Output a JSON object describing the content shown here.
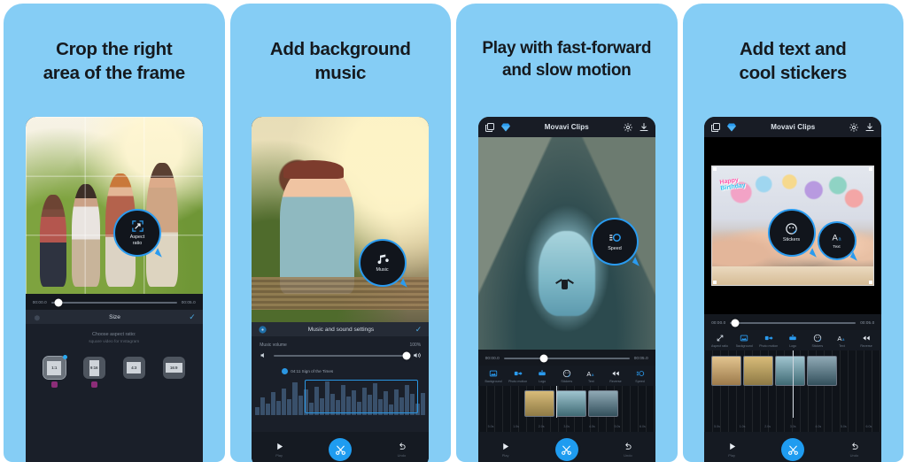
{
  "theme": {
    "panel_bg": "#85cdf5",
    "page_bg": "#ffffff",
    "accent": "#1f9cf0",
    "callout_border": "#2a9bef",
    "phone_bg": "#11141b",
    "heading_color": "#15191e"
  },
  "app": {
    "name": "Movavi Clips"
  },
  "panels": [
    {
      "id": "crop",
      "headline_line1": "Crop the right",
      "headline_line2": "area of the frame",
      "callout": {
        "label_line1": "Aspect",
        "label_line2": "ratio",
        "icon": "aspect-ratio-icon"
      },
      "seek": {
        "start_time": "00:00.0",
        "end_time": "00:05.0"
      },
      "section": {
        "title": "Size",
        "confirm_icon": "check-icon",
        "gear_icon": "gear-icon",
        "prompt": "Choose aspect ratio:",
        "hint": "square video for Instagram",
        "ratios": [
          {
            "label": "1:1",
            "selected": true,
            "pro": true
          },
          {
            "label": "9:16",
            "selected": false,
            "pro": true
          },
          {
            "label": "4:3",
            "selected": false,
            "pro": false
          },
          {
            "label": "16:9",
            "selected": false,
            "pro": false
          }
        ]
      }
    },
    {
      "id": "music",
      "headline_line1": "Add background",
      "headline_line2": "music",
      "callout": {
        "label_line1": "Music",
        "label_line2": "",
        "icon": "music-note-icon"
      },
      "section": {
        "title": "Music and sound settings",
        "confirm_icon": "check-icon",
        "gear_icon": "gear-icon",
        "volume_label": "Music volume",
        "volume_value": "100%",
        "volume_min_icon": "speaker-low-icon",
        "volume_max_icon": "speaker-high-icon",
        "track_name": "04:11 Sign of the Times"
      },
      "bottombar": {
        "play_label": "Play",
        "undo_label": "Undo",
        "cut_icon": "scissors-icon"
      }
    },
    {
      "id": "speed",
      "headline_line1": "Play with fast-forward",
      "headline_line2": "and slow motion",
      "callout": {
        "label_line1": "Speed",
        "label_line2": "",
        "icon": "speed-icon"
      },
      "header": {
        "title": "Movavi Clips",
        "left_icons": [
          "layers-icon",
          "diamond-icon"
        ],
        "right_icons": [
          "gear-icon",
          "download-icon"
        ]
      },
      "seek": {
        "start_time": "00:00.0",
        "end_time": "00:05.0"
      },
      "tools": [
        {
          "label": "Background",
          "icon": "background-icon"
        },
        {
          "label": "Photo motion",
          "icon": "photo-motion-icon"
        },
        {
          "label": "Logo",
          "icon": "logo-icon"
        },
        {
          "label": "Stickers",
          "icon": "stickers-icon"
        },
        {
          "label": "Text",
          "icon": "text-icon"
        },
        {
          "label": "Reverse",
          "icon": "reverse-icon"
        },
        {
          "label": "Speed",
          "icon": "speed-icon"
        }
      ],
      "timeline": {
        "times": [
          "5.0s",
          "1.0s",
          "2.0s",
          "3.0s",
          "4.0s",
          "5.0s",
          "6.0s"
        ]
      },
      "bottombar": {
        "play_label": "Play",
        "undo_label": "Undo",
        "cut_icon": "scissors-icon"
      }
    },
    {
      "id": "text-stickers",
      "headline_line1": "Add text and",
      "headline_line2": "cool stickers",
      "callouts": [
        {
          "label_line1": "Stickers",
          "label_line2": "",
          "icon": "stickers-icon"
        },
        {
          "label_line1": "Text",
          "label_line2": "",
          "icon": "text-icon"
        }
      ],
      "header": {
        "title": "Movavi Clips",
        "left_icons": [
          "layers-icon",
          "diamond-icon"
        ],
        "right_icons": [
          "gear-icon",
          "download-icon"
        ]
      },
      "sticker_text_line1": "Happy",
      "sticker_text_line2": "Birthday",
      "seek": {
        "start_time": "00:00.0",
        "end_time": "00:05.0"
      },
      "tools": [
        {
          "label": "Aspect ratio",
          "icon": "aspect-ratio-icon"
        },
        {
          "label": "Background",
          "icon": "background-icon"
        },
        {
          "label": "Photo motion",
          "icon": "photo-motion-icon"
        },
        {
          "label": "Logo",
          "icon": "logo-icon"
        },
        {
          "label": "Stickers",
          "icon": "stickers-icon"
        },
        {
          "label": "Text",
          "icon": "text-icon"
        },
        {
          "label": "Reverse",
          "icon": "reverse-icon"
        }
      ],
      "timeline": {
        "times": [
          "5.0s",
          "1.0s",
          "2.0s",
          "3.0s",
          "4.0s",
          "5.0s",
          "6.0s"
        ]
      },
      "bottombar": {
        "play_label": "Play",
        "undo_label": "Undo",
        "cut_icon": "scissors-icon"
      }
    }
  ]
}
